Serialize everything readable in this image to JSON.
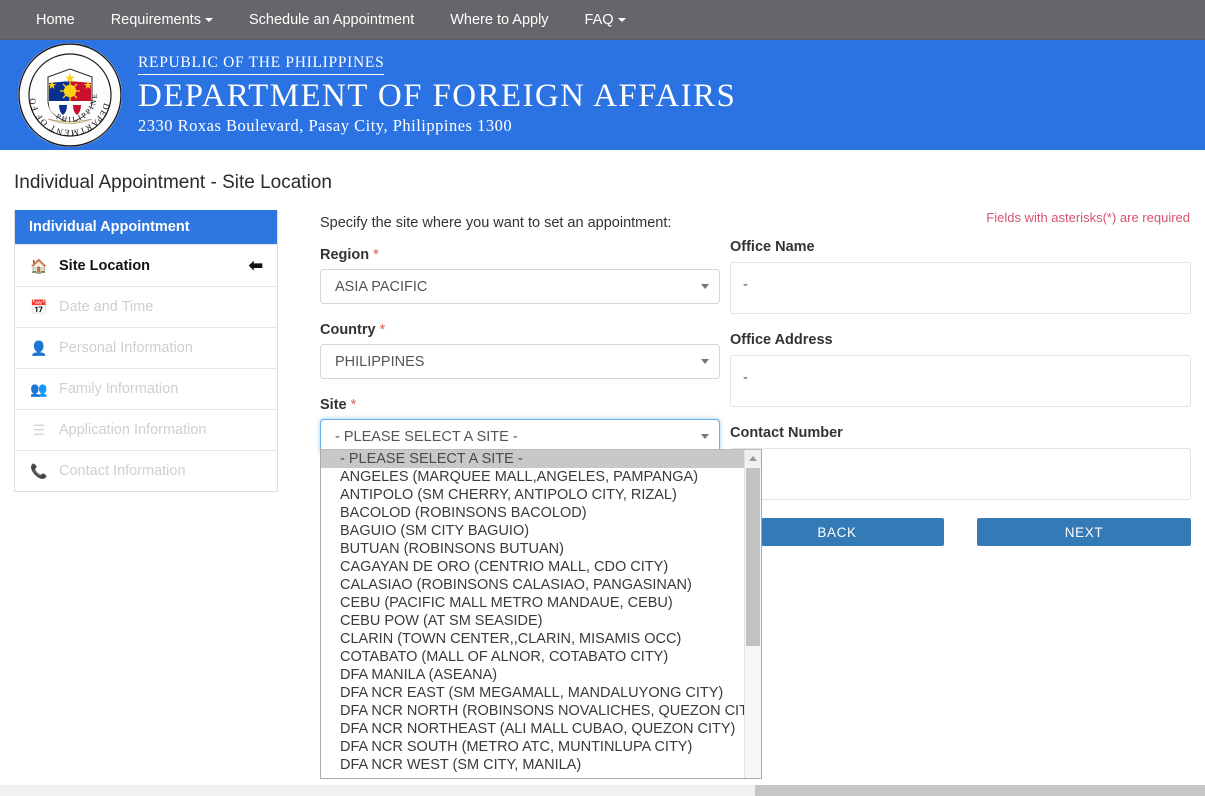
{
  "nav": {
    "items": [
      {
        "label": "Home",
        "caret": false
      },
      {
        "label": "Requirements",
        "caret": true
      },
      {
        "label": "Schedule an Appointment",
        "caret": false
      },
      {
        "label": "Where to Apply",
        "caret": false
      },
      {
        "label": "FAQ",
        "caret": true
      }
    ]
  },
  "banner": {
    "line1": "Republic of the Philippines",
    "line2": "DEPARTMENT OF FOREIGN AFFAIRS",
    "line3": "2330 Roxas Boulevard, Pasay City, Philippines 1300",
    "seal_alt": "dfa-seal",
    "bg_color": "#2b72e3"
  },
  "page": {
    "title": "Individual Appointment - Site Location",
    "required_note": "Fields with asterisks(*) are required"
  },
  "sidebar": {
    "header": "Individual Appointment",
    "header_color": "#2e76e0",
    "items": [
      {
        "label": "Site Location",
        "icon": "home-icon",
        "state": "active"
      },
      {
        "label": "Date and Time",
        "icon": "calendar-icon",
        "state": "disabled"
      },
      {
        "label": "Personal Information",
        "icon": "user-icon",
        "state": "disabled"
      },
      {
        "label": "Family Information",
        "icon": "family-icon",
        "state": "disabled"
      },
      {
        "label": "Application Information",
        "icon": "list-icon",
        "state": "disabled"
      },
      {
        "label": "Contact Information",
        "icon": "phone-icon",
        "state": "disabled"
      }
    ],
    "active_arrow": "arrow-left-icon"
  },
  "form": {
    "intro": "Specify the site where you want to set an appointment:",
    "region": {
      "label": "Region",
      "required": "*",
      "value": "ASIA PACIFIC"
    },
    "country": {
      "label": "Country",
      "required": "*",
      "value": "PHILIPPINES"
    },
    "site": {
      "label": "Site",
      "required": "*",
      "value": "- PLEASE SELECT A SITE -"
    },
    "site_options": [
      "- PLEASE SELECT A SITE -",
      "ANGELES (MARQUEE MALL,ANGELES, PAMPANGA)",
      "ANTIPOLO (SM CHERRY, ANTIPOLO CITY, RIZAL)",
      "BACOLOD (ROBINSONS BACOLOD)",
      "BAGUIO (SM CITY BAGUIO)",
      "BUTUAN (ROBINSONS BUTUAN)",
      "CAGAYAN DE ORO (CENTRIO MALL, CDO CITY)",
      "CALASIAO (ROBINSONS CALASIAO, PANGASINAN)",
      "CEBU (PACIFIC MALL METRO MANDAUE, CEBU)",
      "CEBU POW (AT SM SEASIDE)",
      "CLARIN (TOWN CENTER,,CLARIN, MISAMIS OCC)",
      "COTABATO (MALL OF ALNOR, COTABATO CITY)",
      "DFA MANILA (ASEANA)",
      "DFA NCR EAST (SM MEGAMALL, MANDALUYONG CITY)",
      "DFA NCR NORTH (ROBINSONS NOVALICHES, QUEZON CITY)",
      "DFA NCR NORTHEAST (ALI MALL CUBAO, QUEZON CITY)",
      "DFA NCR SOUTH (METRO ATC, MUNTINLUPA CITY)",
      "DFA NCR WEST (SM CITY, MANILA)"
    ],
    "selected_option_index": 0
  },
  "office": {
    "name_label": "Office Name",
    "name_value": "-",
    "address_label": "Office Address",
    "address_value": "-",
    "contact_label": "Contact Number",
    "contact_value": "-"
  },
  "buttons": {
    "back": "BACK",
    "next": "NEXT",
    "color": "#337ab7"
  }
}
